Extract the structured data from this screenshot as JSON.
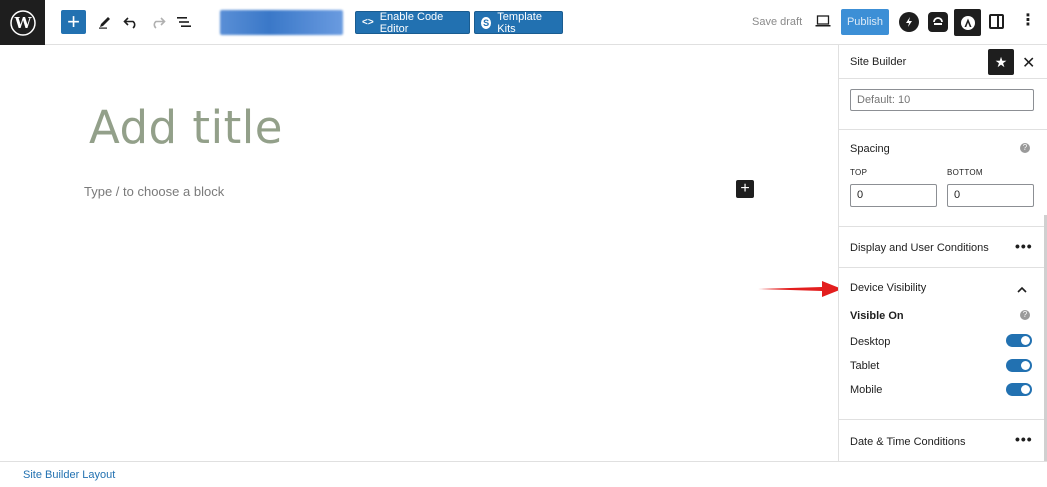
{
  "toolbar": {
    "logo_icon": "wordpress-icon",
    "add_block_label": "+",
    "tools_icon": "pencil-icon",
    "undo_icon": "undo-icon",
    "redo_icon": "redo-icon",
    "list_view_icon": "list-view-icon",
    "code_editor_label": "Enable Code Editor",
    "template_kits_label": "Template Kits",
    "save_draft_label": "Save draft",
    "preview_icon": "laptop-icon",
    "publish_label": "Publish",
    "settings_icon": "sidebar-icon",
    "options_label": "⋮"
  },
  "canvas": {
    "title_placeholder": "Add title",
    "block_placeholder": "Type / to choose a block",
    "inline_add_label": "+"
  },
  "sidebar": {
    "title": "Site Builder",
    "star_label": "★",
    "close_label": "✕",
    "default_field_placeholder": "Default: 10",
    "spacing": {
      "label": "Spacing",
      "top_label": "TOP",
      "bottom_label": "BOTTOM",
      "top_value": "0",
      "bottom_value": "0"
    },
    "display_conditions_label": "Display and User Conditions",
    "device_visibility": {
      "label": "Device Visibility",
      "visible_on_label": "Visible On",
      "devices": [
        {
          "label": "Desktop",
          "enabled": true
        },
        {
          "label": "Tablet",
          "enabled": true
        },
        {
          "label": "Mobile",
          "enabled": true
        }
      ]
    },
    "date_time_label": "Date & Time Conditions",
    "more_label": "•••",
    "help_label": "?"
  },
  "footer": {
    "breadcrumb": "Site Builder Layout"
  },
  "colors": {
    "accent": "#2271b1",
    "dark": "#1e1e1e",
    "arrow": "#e31e1e"
  }
}
